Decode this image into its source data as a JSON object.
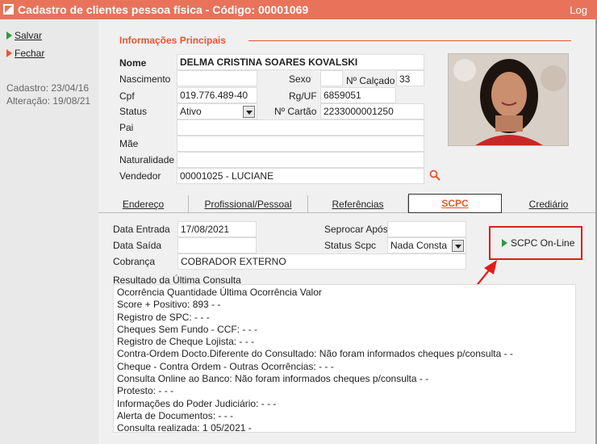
{
  "window": {
    "title": "Cadastro de clientes pessoa física - Código: 00001069",
    "log": "Log"
  },
  "sidebar": {
    "save": "Salvar",
    "close": "Fechar",
    "cadastro": "Cadastro: 23/04/16",
    "alteracao": "Alteração: 19/08/21"
  },
  "main": {
    "section_title": "Informações Principais",
    "labels": {
      "nome": "Nome",
      "nascimento": "Nascimento",
      "sexo": "Sexo",
      "calcado": "Nº Calçado",
      "cpf": "Cpf",
      "rg": "Rg/UF",
      "status": "Status",
      "cartao": "Nº Cartão",
      "pai": "Pai",
      "mae": "Mãe",
      "naturalidade": "Naturalidade",
      "vendedor": "Vendedor"
    },
    "values": {
      "nome": "DELMA CRISTINA SOARES KOVALSKI",
      "nascimento": "",
      "sexo": "",
      "calcado": "33",
      "cpf": "019.776.489-40",
      "rg": "6859051",
      "status": "Ativo",
      "cartao": "2233000001250",
      "pai": "",
      "mae": "",
      "naturalidade": "",
      "vendedor": "00001025 - LUCIANE"
    }
  },
  "tabs": [
    "Endereço",
    "Profissional/Pessoal",
    "Referências",
    "SCPC",
    "Crediário"
  ],
  "scpc": {
    "labels": {
      "data_entrada": "Data Entrada",
      "data_saida": "Data Saída",
      "cobranca": "Cobrança",
      "seprocar": "Seprocar Após",
      "status_scpc": "Status Scpc",
      "resultado": "Resultado da Última Consulta"
    },
    "values": {
      "data_entrada": "17/08/2021",
      "data_saida": "",
      "cobranca": "COBRADOR EXTERNO",
      "seprocar": "",
      "status_scpc": "Nada Consta"
    },
    "online_button": "SCPC On-Line",
    "result_lines": [
      "Ocorrência   Quantidade   Última Ocorrência   Valor",
      "Score + Positivo:   893   -   -",
      "Registro de SPC:   -   -   -",
      "Cheques Sem Fundo - CCF:   -   -   -",
      "Registro de Cheque Lojista:   -   -   -",
      "Contra-Ordem Docto.Diferente do Consultado:   Não foram informados cheques p/consulta   -   -",
      "Cheque - Contra Ordem - Outras Ocorrências:   -   -   -",
      "Consulta Online ao Banco:   Não foram informados cheques p/consulta   -   -",
      "Protesto:   -   -   -",
      "Informações do Poder Judiciário:   -   -   -",
      "Alerta de Documentos:   -   -   -",
      "Consulta realizada:   1   05/2021   -"
    ]
  },
  "colors": {
    "titlebar": "#e8735a",
    "accent": "#e8552f",
    "highlight": "#e31b1b",
    "play": "#2e9a3e"
  }
}
